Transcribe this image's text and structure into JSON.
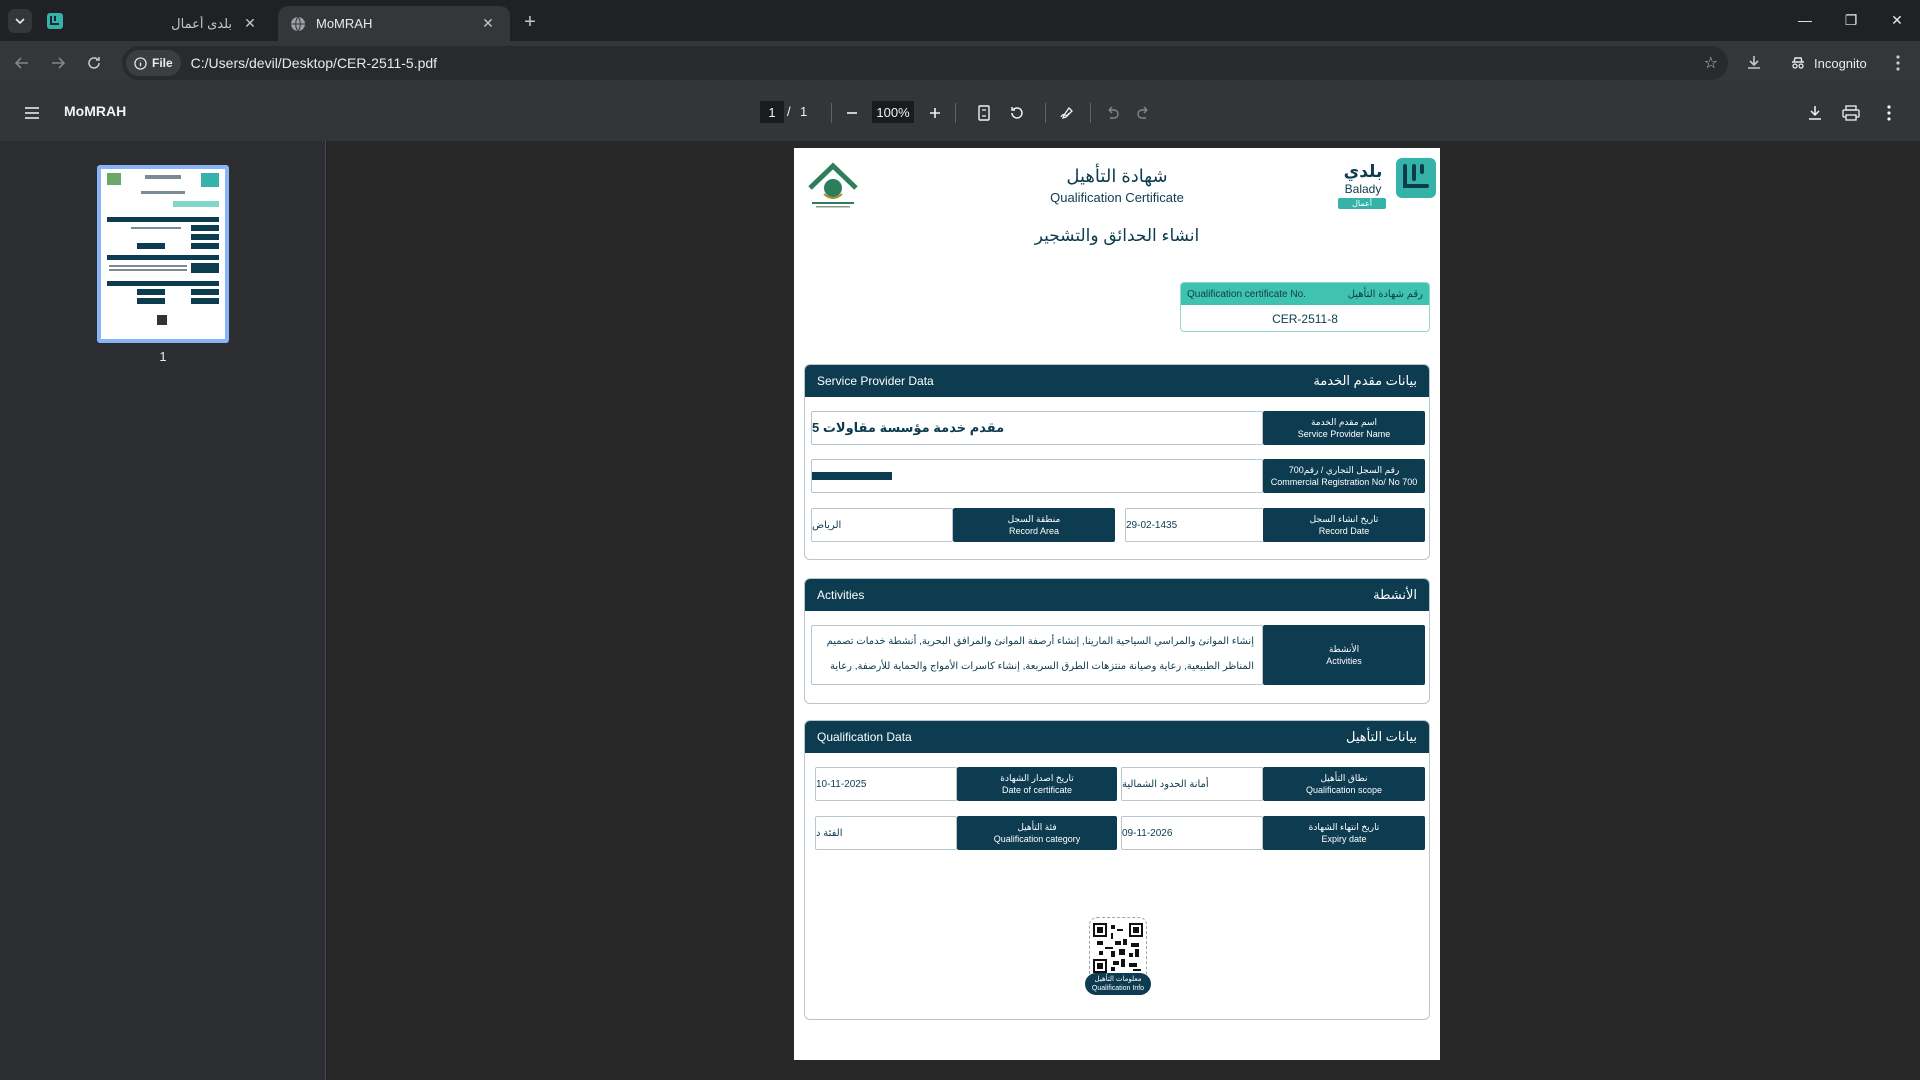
{
  "browser": {
    "tabs": [
      {
        "title": "بلدى أعمال",
        "active": false
      },
      {
        "title": "MoMRAH",
        "active": true
      }
    ],
    "chip_label": "File",
    "url": "C:/Users/devil/Desktop/CER-2511-5.pdf",
    "incognito_label": "Incognito"
  },
  "pdf_viewer": {
    "title": "MoMRAH",
    "current_page": "1",
    "page_separator": "/",
    "total_pages": "1",
    "zoom": "100%",
    "thumbnail_label": "1"
  },
  "document": {
    "logo_right_ar": "بلدي",
    "logo_right_en": "Balady",
    "logo_right_tag": "أعمال",
    "title_ar": "شهادة التأهيل",
    "title_en": "Qualification Certificate",
    "main_activity": "انشاء الحدائق والتشجير",
    "cert_no_label_ar": "رقم شهادة التأهيل",
    "cert_no_label_en": "Qualification certificate No.",
    "cert_no": "CER-2511-8",
    "provider_section": {
      "title_en": "Service Provider Data",
      "title_ar": "بيانات مقدم الخدمة",
      "name_label_ar": "اسم مقدم الخدمة",
      "name_label_en": "Service Provider Name",
      "name_value": "مقدم خدمة مؤسسة مقاولات 5",
      "cr_label_ar": "رقم السجل التجاري / رقم700",
      "cr_label_en": "Commercial Registration No/ No 700",
      "record_date_label_ar": "تاريخ انشاء السجل",
      "record_date_label_en": "Record Date",
      "record_date_value": "29-02-1435",
      "record_area_label_ar": "منطقة السجل",
      "record_area_label_en": "Record Area",
      "record_area_value": "الرياض"
    },
    "activities_section": {
      "title_en": "Activities",
      "title_ar": "الأنشطة",
      "label_ar": "الأنشطة",
      "label_en": "Activities",
      "text": "إنشاء الموانئ والمراسي السياحية المارينا, إنشاء أرصفة الموانئ والمرافق البحرية, أنشطة خدمات تصميم المناظر الطبيعية, رعاية وصيانة منتزهات الطرق السريعة, إنشاء كاسرات الأمواج والحماية للأرصفة, رعاية"
    },
    "qualification_section": {
      "title_en": "Qualification Data",
      "title_ar": "بيانات التأهيل",
      "scope_label_ar": "نطاق التأهيل",
      "scope_label_en": "Qualification scope",
      "scope_value": "أمانة الحدود الشمالية",
      "date_label_ar": "تاريخ اصدار الشهادة",
      "date_label_en": "Date of certificate",
      "date_value": "10-11-2025",
      "expiry_label_ar": "تاريخ انتهاء الشهادة",
      "expiry_label_en": "Expiry date",
      "expiry_value": "09-11-2026",
      "category_label_ar": "فئة التأهيل",
      "category_label_en": "Qualification category",
      "category_value": "الفئة د"
    },
    "qr_label_ar": "معلومات التأهيل",
    "qr_label_en": "Qualification Info"
  }
}
